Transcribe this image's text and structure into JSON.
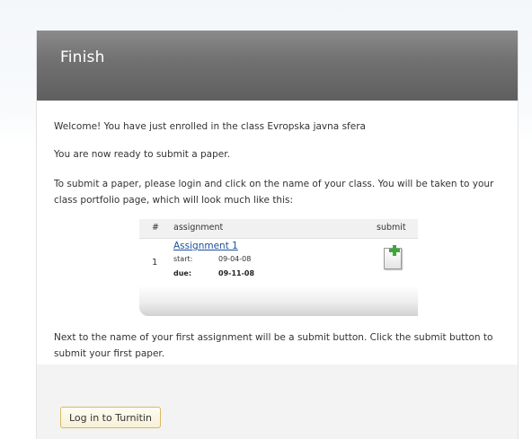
{
  "header": {
    "title": "Finish"
  },
  "content": {
    "welcome": "Welcome! You have just enrolled in the class Evropska javna sfera",
    "ready": "You are now ready to submit a paper.",
    "instructions": "To submit a paper, please login and click on the name of your class. You will be taken to your class portfolio page, which will look much like this:",
    "next_step": "Next to the name of your first assignment will be a submit button. Click the submit button to submit your first paper."
  },
  "preview": {
    "columns": [
      "#",
      "assignment",
      "submit"
    ],
    "row": {
      "number": "1",
      "assignment_name": "Assignment 1",
      "start_label": "start:",
      "start_value": "09-04-08",
      "due_label": "due:",
      "due_value": "09-11-08",
      "submit_icon": "add-document-icon"
    }
  },
  "footer": {
    "login_button": "Log in to Turnitin"
  },
  "colors": {
    "header_bg": "#6f6f6f",
    "link": "#1a4f9c",
    "button_border": "#d8b960",
    "plus_green": "#3da83a"
  }
}
